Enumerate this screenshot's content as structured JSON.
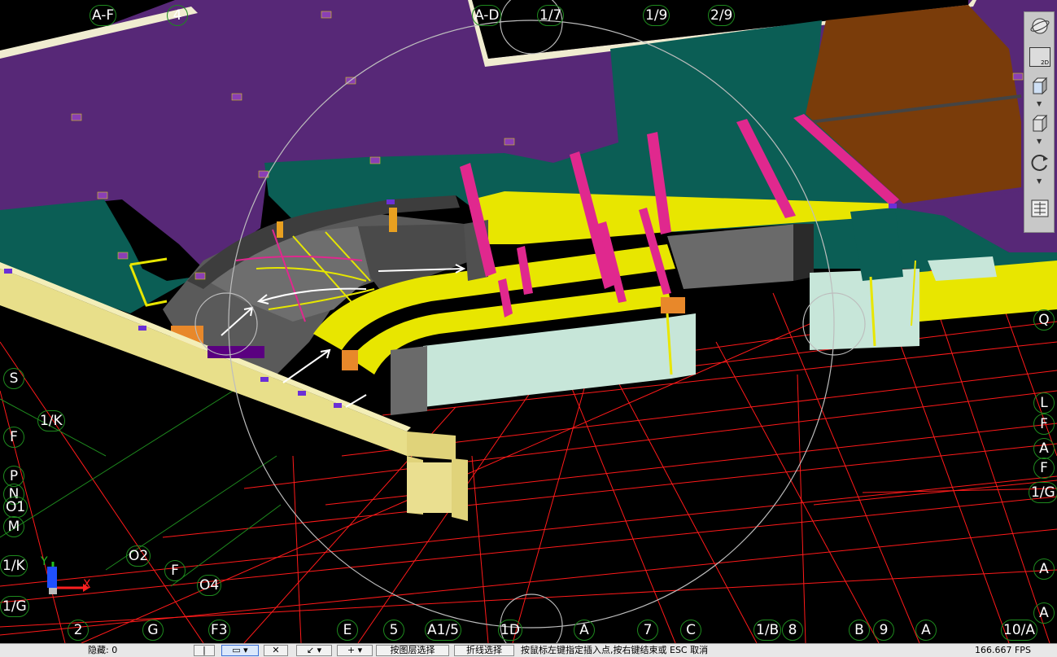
{
  "axis_labels": [
    {
      "text": "A-F"
    },
    {
      "text": "4"
    },
    {
      "text": "A-D"
    },
    {
      "text": "1/7"
    },
    {
      "text": "1/9"
    },
    {
      "text": "2/9"
    },
    {
      "text": "S"
    },
    {
      "text": "1/K"
    },
    {
      "text": "F"
    },
    {
      "text": "P"
    },
    {
      "text": "N"
    },
    {
      "text": "O1"
    },
    {
      "text": "M"
    },
    {
      "text": "O2"
    },
    {
      "text": "F"
    },
    {
      "text": "O4"
    },
    {
      "text": "1/K"
    },
    {
      "text": "1/G"
    },
    {
      "text": "2"
    },
    {
      "text": "G"
    },
    {
      "text": "F3"
    },
    {
      "text": "E"
    },
    {
      "text": "5"
    },
    {
      "text": "A1/5"
    },
    {
      "text": "1D"
    },
    {
      "text": "A"
    },
    {
      "text": "7"
    },
    {
      "text": "C"
    },
    {
      "text": "1/B"
    },
    {
      "text": "8"
    },
    {
      "text": "B"
    },
    {
      "text": "9"
    },
    {
      "text": "A"
    },
    {
      "text": "10/A"
    },
    {
      "text": "Q"
    },
    {
      "text": "L"
    },
    {
      "text": "F"
    },
    {
      "text": "A"
    },
    {
      "text": "F"
    },
    {
      "text": "1/G"
    },
    {
      "text": "A"
    },
    {
      "text": "A"
    }
  ],
  "ucs_icon": {
    "x_label": "X",
    "y_label": "Y"
  },
  "toolbar": {
    "view_2d_label": "2D"
  },
  "statusbar": {
    "hidden_count_label": "隐藏: 0",
    "pick_by_layer": "按图层选择",
    "polyline_select": "折线选择",
    "prompt": "按鼠标左键指定插入点,按右键结束或 ESC 取消",
    "fps": "166.667 FPS"
  }
}
